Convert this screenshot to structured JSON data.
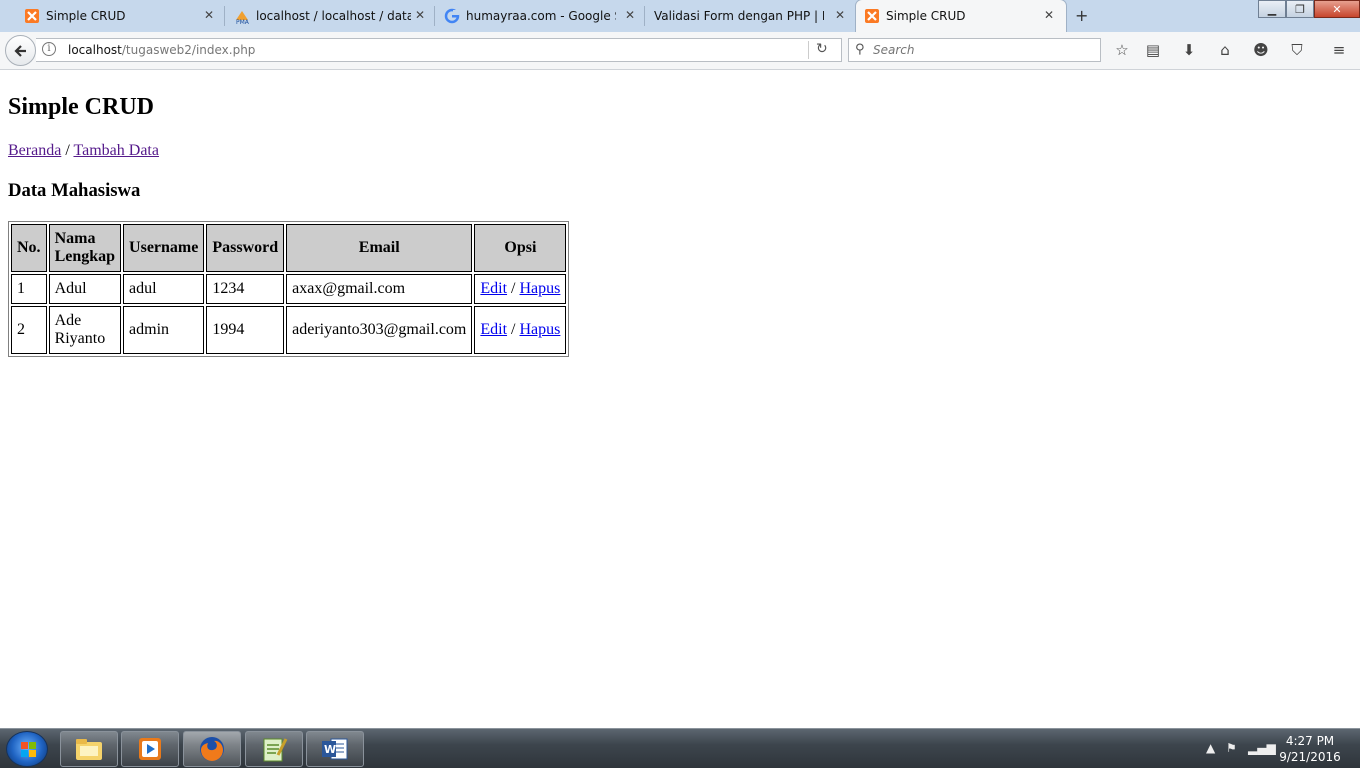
{
  "browser": {
    "tabs": [
      {
        "label": "Simple CRUD",
        "icon": "xampp-icon",
        "active": false
      },
      {
        "label": "localhost / localhost / data...",
        "icon": "phpmyadmin-icon",
        "active": false
      },
      {
        "label": "humayraa.com - Google S...",
        "icon": "google-icon",
        "active": false
      },
      {
        "label": "Validasi Form dengan PHP | H...",
        "icon": "none",
        "active": false
      },
      {
        "label": "Simple CRUD",
        "icon": "xampp-icon",
        "active": true
      }
    ],
    "url_host": "localhost",
    "url_path": "/tugasweb2/index.php",
    "search_placeholder": "Search"
  },
  "page": {
    "title": "Simple CRUD",
    "breadcrumb": {
      "home": "Beranda",
      "separator": " / ",
      "add": "Tambah Data"
    },
    "section_title": "Data Mahasiswa",
    "table": {
      "headers": [
        "No.",
        "Nama Lengkap",
        "Username",
        "Password",
        "Email",
        "Opsi"
      ],
      "rows": [
        {
          "no": "1",
          "nama": "Adul",
          "username": "adul",
          "password": "1234",
          "email": "axax@gmail.com"
        },
        {
          "no": "2",
          "nama": "Ade Riyanto",
          "username": "admin",
          "password": "1994",
          "email": "aderiyanto303@gmail.com"
        }
      ],
      "edit_label": "Edit",
      "delete_label": "Hapus",
      "action_separator": " / "
    }
  },
  "taskbar": {
    "time": "4:27 PM",
    "date": "9/21/2016",
    "apps": [
      "file-explorer-icon",
      "media-player-icon",
      "firefox-icon",
      "notepad-plus-icon",
      "word-icon"
    ]
  },
  "colors": {
    "visited_link": "#551a8b",
    "link": "#0000ee",
    "header_cell": "#cccccc",
    "tab_strip": "#c6d8ec"
  }
}
